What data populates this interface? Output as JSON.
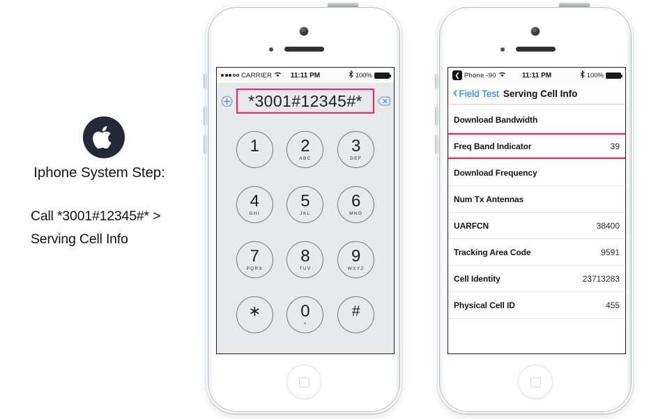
{
  "instructions": {
    "logo_icon": "apple-logo-icon",
    "title": "Iphone System Step:",
    "line1": "Call *3001#12345#* >",
    "line2": "Serving Cell Info"
  },
  "colors": {
    "highlight_border": "#d9336b",
    "highlight_inner": "#f6c9d8",
    "ios_blue": "#0a7cff",
    "logo_bg": "#252836"
  },
  "dialer_phone": {
    "status_bar": {
      "signal_dots_filled": 3,
      "signal_dots_hollow": 2,
      "carrier": "CARRIER",
      "wifi_icon": "wifi-icon",
      "time": "11:11 PM",
      "bluetooth_icon": "bluetooth-icon",
      "battery_percent": "100%"
    },
    "dial_field": {
      "add_contact_icon": "circled-plus-icon",
      "value": "*3001#12345#*",
      "delete_icon": "backspace-delete-icon",
      "highlighted": true
    },
    "keypad": [
      {
        "digit": "1",
        "letters": ""
      },
      {
        "digit": "2",
        "letters": "ABC"
      },
      {
        "digit": "3",
        "letters": "DEF"
      },
      {
        "digit": "4",
        "letters": "GHI"
      },
      {
        "digit": "5",
        "letters": "JKL"
      },
      {
        "digit": "6",
        "letters": "MNO"
      },
      {
        "digit": "7",
        "letters": "PQRS"
      },
      {
        "digit": "8",
        "letters": "TUV"
      },
      {
        "digit": "9",
        "letters": "WXYZ"
      },
      {
        "digit": "∗",
        "letters": ""
      },
      {
        "digit": "0",
        "letters": "+"
      },
      {
        "digit": "#",
        "letters": ""
      }
    ]
  },
  "fieldtest_phone": {
    "status_bar": {
      "back_badge_icon": "back-chevron-badge-icon",
      "carrier": "Phone -90",
      "wifi_icon": "wifi-icon",
      "time": "11:11 PM",
      "bluetooth_icon": "bluetooth-icon",
      "battery_percent": "100%"
    },
    "navbar": {
      "back_chevron_icon": "chevron-left-icon",
      "back_label": "Field Test",
      "title": "Serving Cell Info"
    },
    "rows": [
      {
        "label": "Download Bandwidth",
        "value": "",
        "highlighted": false
      },
      {
        "label": "Freq Band Indicator",
        "value": "39",
        "highlighted": true
      },
      {
        "label": "Download Frequency",
        "value": "",
        "highlighted": false
      },
      {
        "label": "Num Tx Antennas",
        "value": "",
        "highlighted": false
      },
      {
        "label": "UARFCN",
        "value": "38400",
        "highlighted": false
      },
      {
        "label": "Tracking Area Code",
        "value": "9591",
        "highlighted": false
      },
      {
        "label": "Cell Identity",
        "value": "23713283",
        "highlighted": false
      },
      {
        "label": "Physical Cell ID",
        "value": "455",
        "highlighted": false
      }
    ]
  }
}
